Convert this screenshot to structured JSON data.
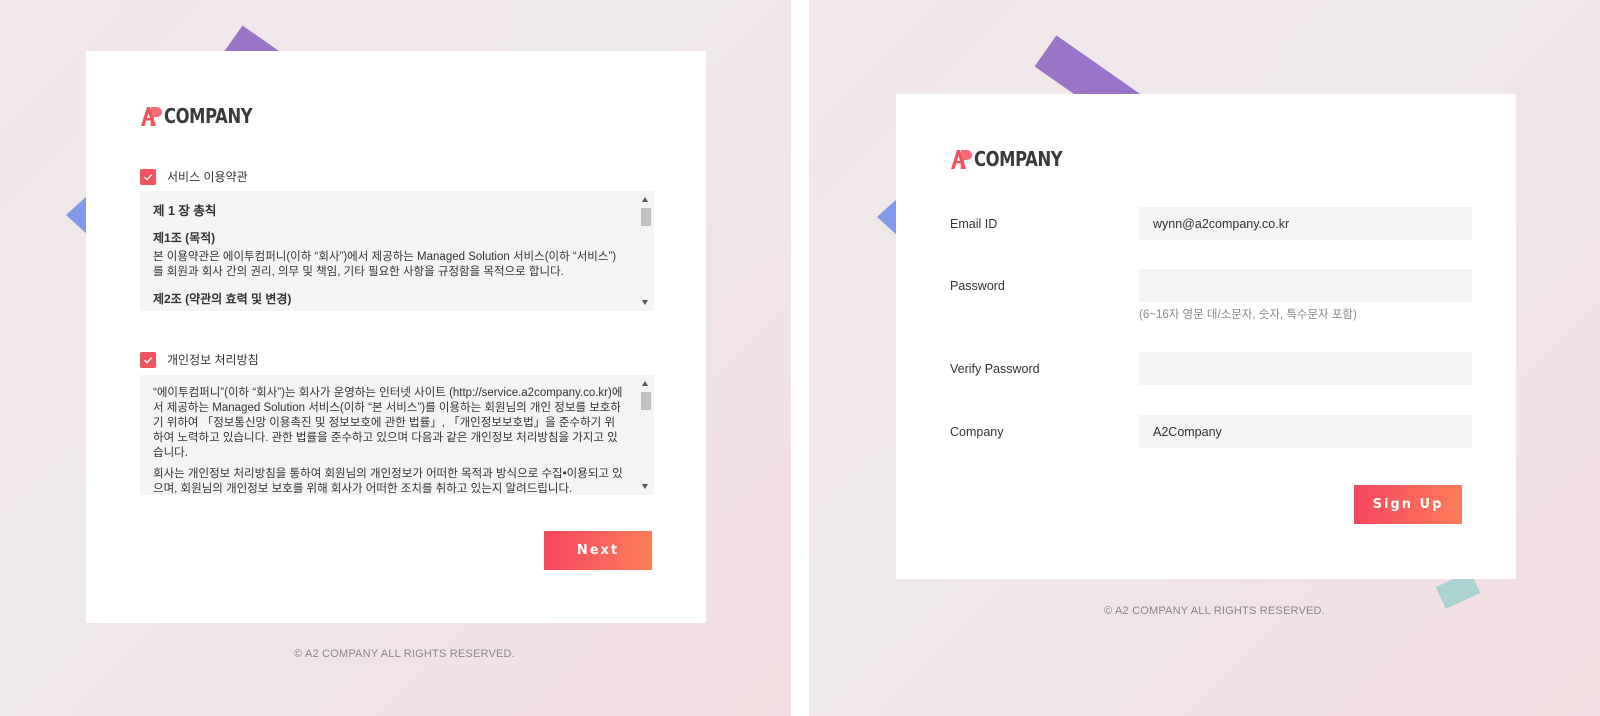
{
  "brand": {
    "logo_mark": "A2",
    "logo_text": "COMPANY",
    "accent_color": "#f1545e"
  },
  "terms_step": {
    "service_terms": {
      "checkbox_label": "서비스 이용약관",
      "checked": true,
      "chapter_title": "제 1 장 총칙",
      "article_title": "제1조 (목적)",
      "article_body": "본 이용약관은 에이투컴퍼니(이하 “회사”)에서 제공하는 Managed Solution 서비스(이하 “서비스”)를 회원과 회사 간의 권리, 의무 및 책임, 기타 필요한 사항을 규정함을 목적으로 합니다.",
      "next_article_title": "제2조 (약관의 효력 및 변경)"
    },
    "privacy_policy": {
      "checkbox_label": "개인정보 처리방침",
      "checked": true,
      "paragraph_1": "“에이투컴퍼니”(이하 “회사”)는 회사가 운영하는 인터넷 사이트 (http://service.a2company.co.kr)에서 제공하는 Managed Solution 서비스(이하 “본 서비스”)를 이용하는 회원님의 개인 정보를 보호하기 위하여 「정보통신망 이용촉진 및 정보보호에 관한 법률」, 「개인정보보호법」을 준수하기 위하여 노력하고 있습니다. 관한 법률을 준수하고 있으며 다음과 같은 개인정보 처리방침을 가지고 있습니다.",
      "paragraph_2": "회사는 개인정보 처리방침을 통하여 회원님의 개인정보가 어떠한 목적과 방식으로 수집•이용되고 있으며, 회원님의 개인정보 보호를 위해 회사가 어떠한 조치를 취하고 있는지 알려드립니다."
    },
    "next_button": "Next",
    "copyright": "© A2 COMPANY ALL RIGHTS RESERVED."
  },
  "signup_step": {
    "email": {
      "label": "Email ID",
      "value": "wynn@a2company.co.kr"
    },
    "password": {
      "label": "Password",
      "value": "",
      "hint": "(6~16자 영문 대/소문자, 숫자, 특수문자 포함)"
    },
    "verify_password": {
      "label": "Verify Password",
      "value": ""
    },
    "company": {
      "label": "Company",
      "value": "A2Company"
    },
    "signup_button": "Sign Up",
    "copyright": "© A2 COMPANY ALL RIGHTS RESERVED."
  },
  "icons": [
    "check-icon",
    "scroll-up-arrow-icon",
    "scroll-down-arrow-icon"
  ]
}
